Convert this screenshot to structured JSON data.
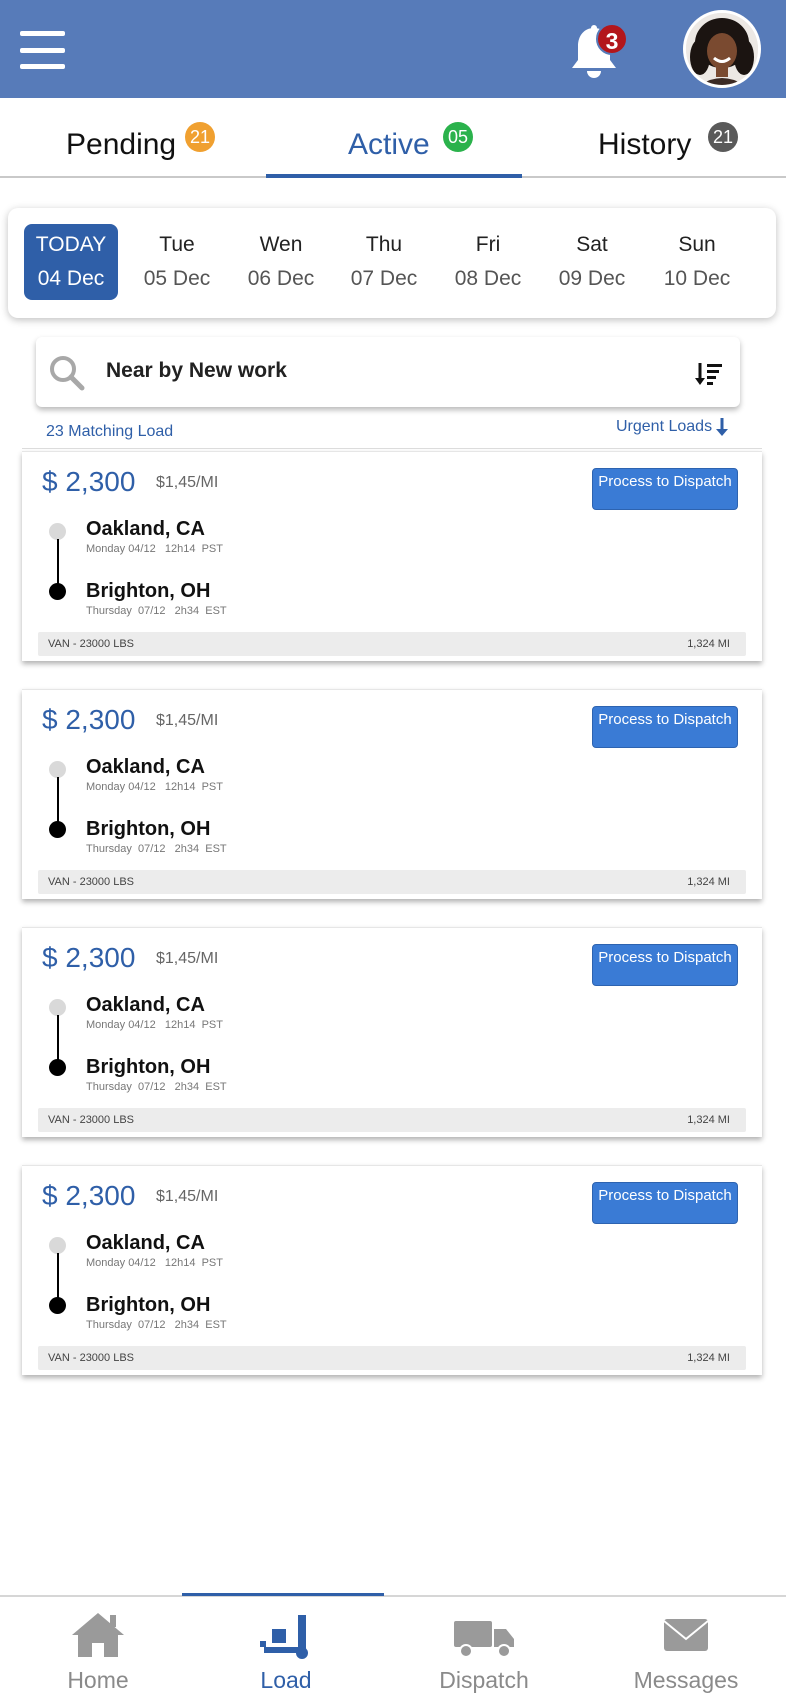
{
  "header": {
    "notification_count": "3",
    "menu_icon": "hamburger-menu-icon",
    "bell_icon": "bell-icon",
    "avatar_icon": "user-avatar-photo"
  },
  "tabs": [
    {
      "label": "Pending",
      "badge": "21",
      "badge_color": "#f0a030"
    },
    {
      "label": "Active",
      "badge": "05",
      "badge_color": "#2bb24c",
      "active": true
    },
    {
      "label": "History",
      "badge": "21",
      "badge_color": "#5a5a5a"
    }
  ],
  "dates": [
    {
      "day": "TODAY",
      "date": "04 Dec",
      "selected": true
    },
    {
      "day": "Tue",
      "date": "05 Dec"
    },
    {
      "day": "Wen",
      "date": "06 Dec"
    },
    {
      "day": "Thu",
      "date": "07 Dec"
    },
    {
      "day": "Fri",
      "date": "08 Dec"
    },
    {
      "day": "Sat",
      "date": "09 Dec"
    },
    {
      "day": "Sun",
      "date": "10 Dec"
    }
  ],
  "search": {
    "text": "Near by New work",
    "icon": "search-icon",
    "sort_icon": "sort-descending-icon"
  },
  "results": {
    "matching": "23 Matching Load",
    "urgent": "Urgent Loads",
    "urgent_icon": "arrow-down-icon"
  },
  "loads": [
    {
      "price": "$ 2,300",
      "rate": "$1,45/MI",
      "button": "Process to Dispatch",
      "origin": "Oakland, CA",
      "origin_time": "Monday 04/12   12h14  PST",
      "dest": "Brighton, OH",
      "dest_time": "Thursday  07/12   2h34  EST",
      "equipment": "VAN  -  23000 LBS",
      "distance": "1,324 MI"
    },
    {
      "price": "$ 2,300",
      "rate": "$1,45/MI",
      "button": "Process to Dispatch",
      "origin": "Oakland, CA",
      "origin_time": "Monday 04/12   12h14  PST",
      "dest": "Brighton, OH",
      "dest_time": "Thursday  07/12   2h34  EST",
      "equipment": "VAN  -  23000 LBS",
      "distance": "1,324 MI"
    },
    {
      "price": "$ 2,300",
      "rate": "$1,45/MI",
      "button": "Process to Dispatch",
      "origin": "Oakland, CA",
      "origin_time": "Monday 04/12   12h14  PST",
      "dest": "Brighton, OH",
      "dest_time": "Thursday  07/12   2h34  EST",
      "equipment": "VAN  -  23000 LBS",
      "distance": "1,324 MI"
    },
    {
      "price": "$ 2,300",
      "rate": "$1,45/MI",
      "button": "Process to Dispatch",
      "origin": "Oakland, CA",
      "origin_time": "Monday 04/12   12h14  PST",
      "dest": "Brighton, OH",
      "dest_time": "Thursday  07/12   2h34  EST",
      "equipment": "VAN  -  23000 LBS",
      "distance": "1,324 MI"
    }
  ],
  "nav": [
    {
      "label": "Home",
      "icon": "home-icon"
    },
    {
      "label": "Load",
      "icon": "load-dolly-icon",
      "active": true
    },
    {
      "label": "Dispatch",
      "icon": "truck-icon"
    },
    {
      "label": "Messages",
      "icon": "envelope-icon"
    }
  ],
  "colors": {
    "header_bg": "#577bb9",
    "accent": "#2f5fa8",
    "button": "#3a7bd5",
    "notification_badge": "#b3161b"
  }
}
